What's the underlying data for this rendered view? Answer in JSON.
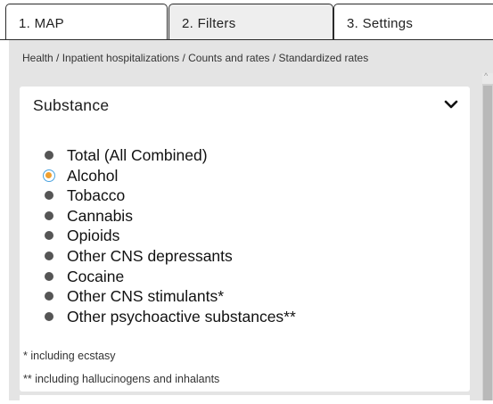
{
  "tabs": [
    {
      "label": "1. MAP"
    },
    {
      "label": "2. Filters"
    },
    {
      "label": "3. Settings"
    }
  ],
  "breadcrumb": "Health / Inpatient hospitalizations / Counts and rates / Standardized rates",
  "filter": {
    "title": "Substance",
    "selected": "Alcohol",
    "options": [
      {
        "label": "Total (All Combined)"
      },
      {
        "label": "Alcohol"
      },
      {
        "label": "Tobacco"
      },
      {
        "label": "Cannabis"
      },
      {
        "label": "Opioids"
      },
      {
        "label": "Other CNS depressants"
      },
      {
        "label": "Cocaine"
      },
      {
        "label": "Other CNS stimulants*"
      },
      {
        "label": "Other psychoactive substances**"
      }
    ],
    "footnotes": [
      "* including ecstasy",
      "** including hallucinogens and inhalants"
    ]
  },
  "colors": {
    "selected_ring": "#4aa3df",
    "selected_fill": "#f0a030",
    "bullet": "#555555"
  },
  "icons": {
    "collapse": "chevron-down-icon",
    "scroll_up": "scroll-up-arrow-icon"
  }
}
